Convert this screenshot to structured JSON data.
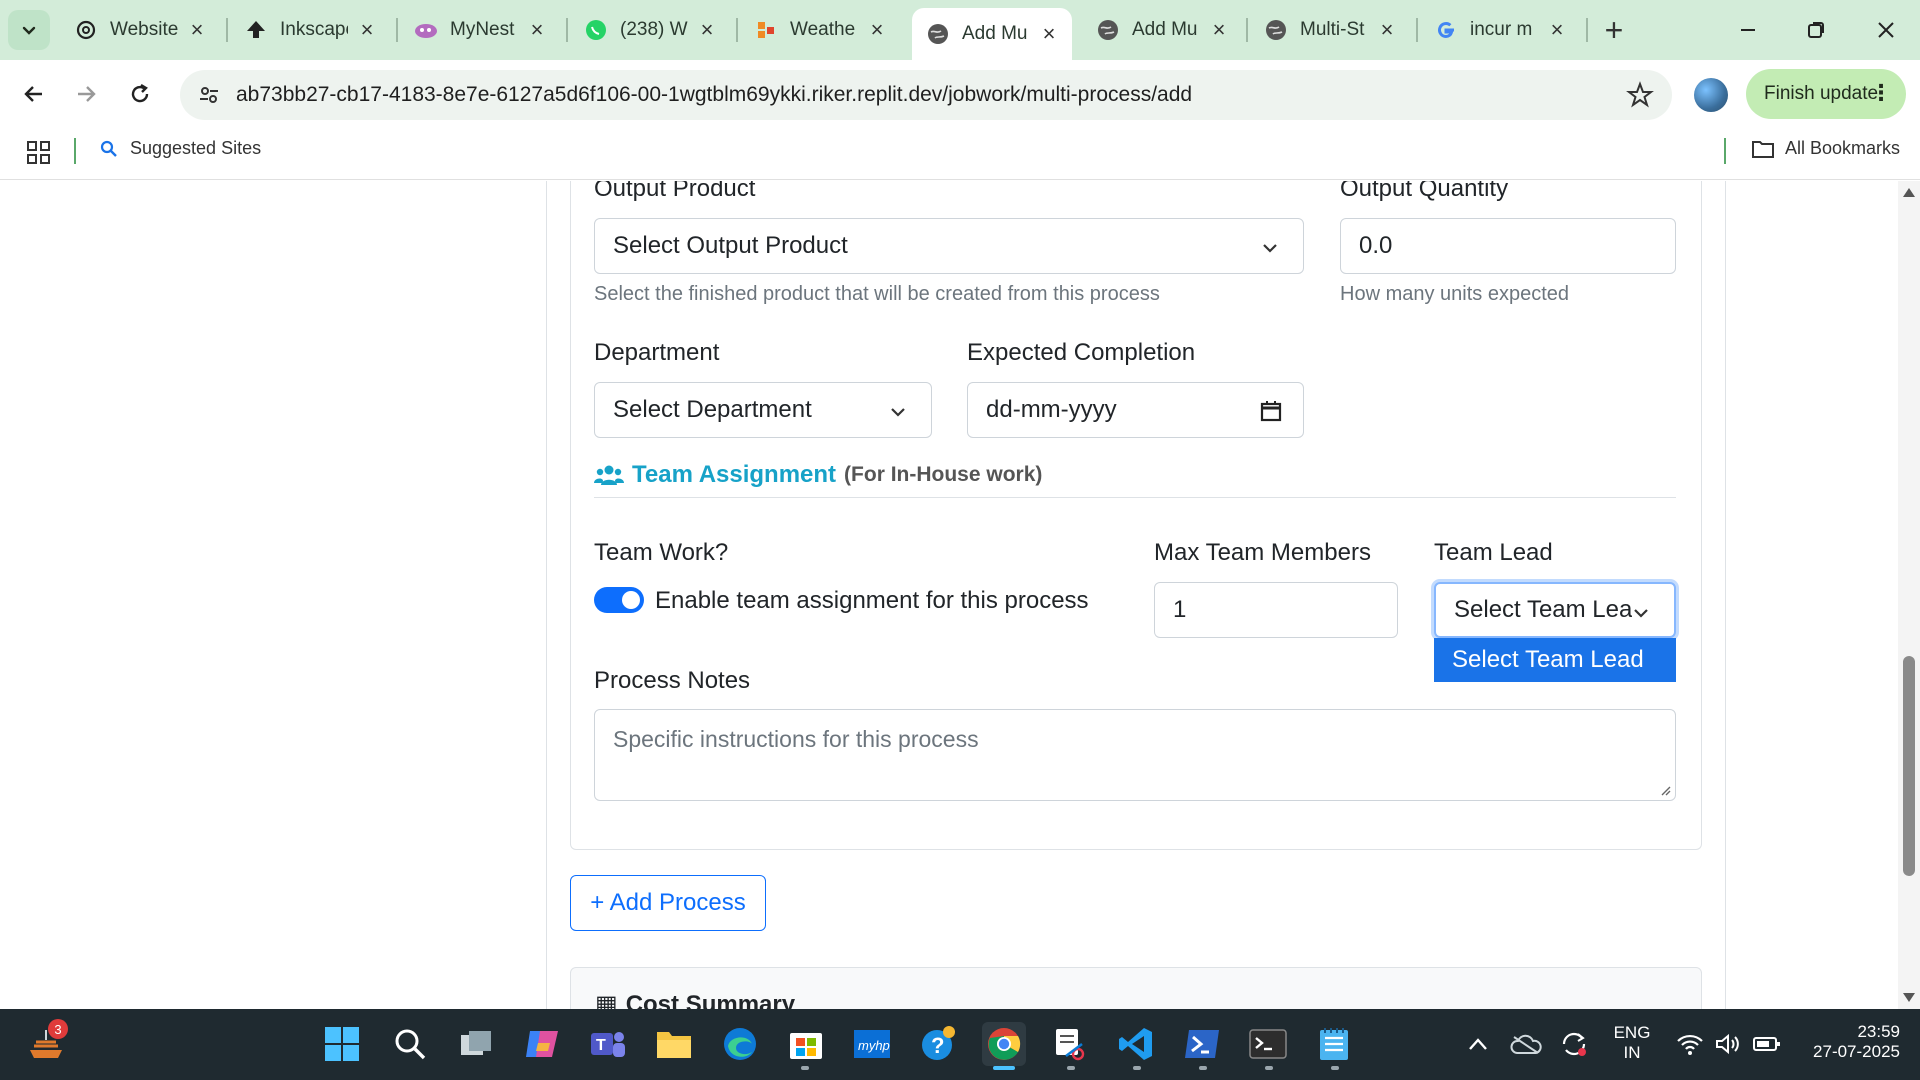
{
  "browser": {
    "tabs": [
      {
        "title": "Website",
        "icon": "openai-icon"
      },
      {
        "title": "Inkscape",
        "icon": "inkscape-icon"
      },
      {
        "title": "MyNest",
        "icon": "mynest-icon"
      },
      {
        "title": "(238) W",
        "icon": "whatsapp-icon"
      },
      {
        "title": "Weathe",
        "icon": "weather-icon"
      },
      {
        "title": "Add Mu",
        "icon": "globe-icon",
        "active": true
      },
      {
        "title": "Add Mu",
        "icon": "globe-icon"
      },
      {
        "title": "Multi-St",
        "icon": "globe-icon"
      },
      {
        "title": "incur m",
        "icon": "google-icon"
      }
    ],
    "url": "ab73bb27-cb17-4183-8e7e-6127a5d6f106-00-1wgtblm69ykki.riker.replit.dev/jobwork/multi-process/add",
    "finish_update_label": "Finish update",
    "bookmarks": {
      "suggested_sites": "Suggested Sites",
      "all_bookmarks": "All Bookmarks"
    }
  },
  "form": {
    "output_product": {
      "label": "Output Product",
      "value": "Select Output Product",
      "help": "Select the finished product that will be created from this process"
    },
    "output_quantity": {
      "label": "Output Quantity",
      "value": "0.0",
      "help": "How many units expected"
    },
    "department": {
      "label": "Department",
      "value": "Select Department"
    },
    "expected_completion": {
      "label": "Expected Completion",
      "placeholder": "dd-mm-yyyy"
    },
    "team_section": {
      "title": "Team Assignment",
      "subtitle": "(For In-House work)"
    },
    "team_work": {
      "label": "Team Work?",
      "toggle_label": "Enable team assignment for this process",
      "enabled": true
    },
    "max_team_members": {
      "label": "Max Team Members",
      "value": "1"
    },
    "team_lead": {
      "label": "Team Lead",
      "value": "Select Team Lea",
      "options": [
        "Select Team Lead"
      ]
    },
    "process_notes": {
      "label": "Process Notes",
      "placeholder": "Specific instructions for this process"
    },
    "add_process_label": "+ Add Process",
    "cost_summary_title": "Cost Summary"
  },
  "taskbar": {
    "notification_count": "3",
    "language": "ENG",
    "region": "IN",
    "time": "23:59",
    "date": "27-07-2025"
  }
}
